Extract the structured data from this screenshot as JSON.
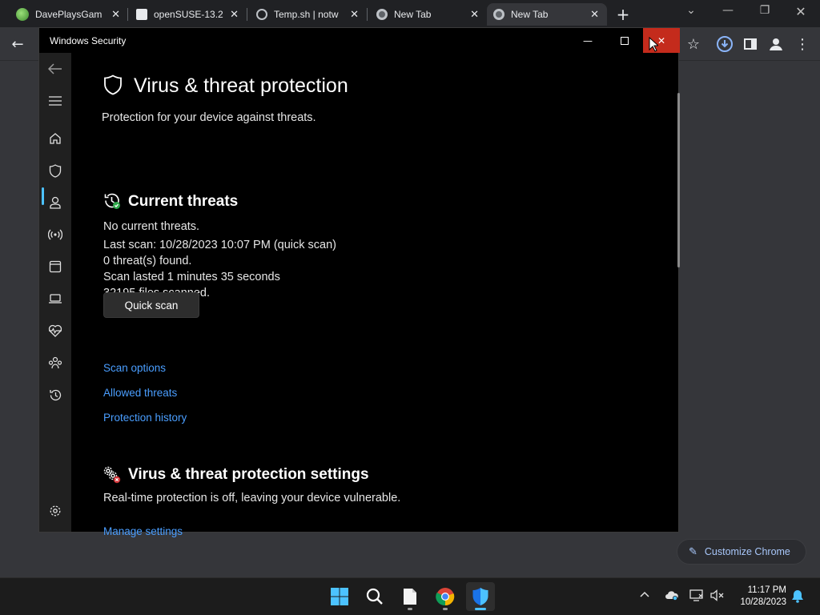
{
  "chrome": {
    "tabs": [
      {
        "title": "DavePlaysGam",
        "favicon": "globe-green-icon",
        "active": false
      },
      {
        "title": "openSUSE-13.2",
        "favicon": "archive-icon",
        "active": false
      },
      {
        "title": "Temp.sh | notw",
        "favicon": "globe-icon",
        "active": false
      },
      {
        "title": "New Tab",
        "favicon": "chrome-icon",
        "active": false
      },
      {
        "title": "New Tab",
        "favicon": "chrome-icon",
        "active": true
      }
    ],
    "customize_label": "Customize Chrome"
  },
  "window": {
    "title": "Windows Security",
    "close_color": "#c42b1c"
  },
  "page": {
    "title": "Virus & threat protection",
    "subtitle": "Protection for your device against threats."
  },
  "current_threats": {
    "heading": "Current threats",
    "lines": [
      "No current threats.",
      "Last scan: 10/28/2023 10:07 PM (quick scan)",
      "0 threat(s) found.",
      "Scan lasted 1 minutes 35 seconds",
      "32195 files scanned."
    ],
    "button": "Quick scan",
    "links": [
      "Scan options",
      "Allowed threats",
      "Protection history"
    ]
  },
  "settings": {
    "heading": "Virus & threat protection settings",
    "status": "Real-time protection is off, leaving your device vulnerable.",
    "link": "Manage settings"
  },
  "sidebar": {
    "items": [
      "back-icon",
      "menu-icon",
      "home-icon",
      "shield-icon",
      "account-icon",
      "firewall-icon",
      "app-browser-icon",
      "device-security-icon",
      "health-icon",
      "family-icon",
      "history-icon",
      "settings-icon"
    ],
    "active": "shield-icon"
  },
  "taskbar": {
    "time": "11:17 PM",
    "date": "10/28/2023"
  },
  "colors": {
    "accent": "#4cc2ff",
    "link": "#4a9eff"
  }
}
